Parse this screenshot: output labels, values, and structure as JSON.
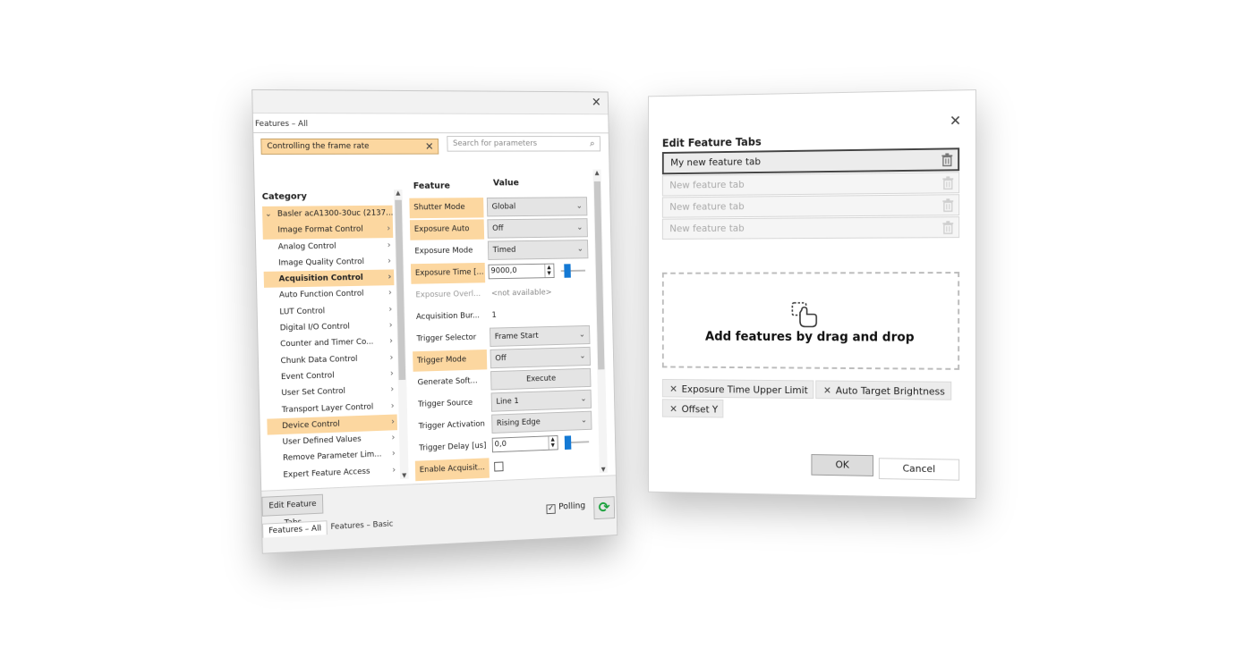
{
  "features_panel": {
    "tab_title": "Features – All",
    "filter_text": "Controlling the frame rate",
    "search_placeholder": "Search for parameters",
    "category_header": "Category",
    "feature_header": "Feature",
    "value_header": "Value",
    "categories": [
      {
        "label": "Basler acA1300-30uc (2137...",
        "highlight": true,
        "bold": false,
        "expanded": true
      },
      {
        "label": "Image Format Control",
        "highlight": true,
        "bold": false
      },
      {
        "label": "Analog Control",
        "highlight": false,
        "bold": false
      },
      {
        "label": "Image Quality Control",
        "highlight": false,
        "bold": false
      },
      {
        "label": "Acquisition Control",
        "highlight": true,
        "bold": true
      },
      {
        "label": "Auto Function Control",
        "highlight": false,
        "bold": false
      },
      {
        "label": "LUT Control",
        "highlight": false,
        "bold": false
      },
      {
        "label": "Digital I/O Control",
        "highlight": false,
        "bold": false
      },
      {
        "label": "Counter and Timer Co...",
        "highlight": false,
        "bold": false
      },
      {
        "label": "Chunk Data Control",
        "highlight": false,
        "bold": false
      },
      {
        "label": "Event Control",
        "highlight": false,
        "bold": false
      },
      {
        "label": "User Set Control",
        "highlight": false,
        "bold": false
      },
      {
        "label": "Transport Layer Control",
        "highlight": false,
        "bold": false
      },
      {
        "label": "Device Control",
        "highlight": true,
        "bold": false
      },
      {
        "label": "User Defined Values",
        "highlight": false,
        "bold": false
      },
      {
        "label": "Remove Parameter Lim...",
        "highlight": false,
        "bold": false
      },
      {
        "label": "Expert Feature Access",
        "highlight": false,
        "bold": false
      }
    ],
    "features": [
      {
        "label": "Shutter Mode",
        "highlight": true,
        "kind": "dropdown",
        "value": "Global"
      },
      {
        "label": "Exposure Auto",
        "highlight": true,
        "kind": "dropdown",
        "value": "Off"
      },
      {
        "label": "Exposure Mode",
        "highlight": false,
        "kind": "dropdown",
        "value": "Timed"
      },
      {
        "label": "Exposure Time [...",
        "highlight": true,
        "kind": "spin",
        "value": "9000,0",
        "slider_fraction": 0.2
      },
      {
        "label": "Exposure Overl...",
        "highlight": false,
        "dim": true,
        "kind": "text",
        "value": "<not available>"
      },
      {
        "label": "Acquisition Bur...",
        "highlight": false,
        "kind": "text",
        "value": "1"
      },
      {
        "label": "Trigger Selector",
        "highlight": false,
        "kind": "dropdown",
        "value": "Frame Start"
      },
      {
        "label": "Trigger Mode",
        "highlight": true,
        "kind": "dropdown",
        "value": "Off"
      },
      {
        "label": "Generate Soft...",
        "highlight": false,
        "kind": "button",
        "value": "Execute"
      },
      {
        "label": "Trigger Source",
        "highlight": false,
        "kind": "dropdown",
        "value": "Line 1"
      },
      {
        "label": "Trigger Activation",
        "highlight": false,
        "kind": "dropdown",
        "value": "Rising Edge"
      },
      {
        "label": "Trigger Delay [us]",
        "highlight": false,
        "kind": "spin",
        "value": "0,0",
        "slider_fraction": 0.0
      },
      {
        "label": "Enable Acquisit...",
        "highlight": true,
        "kind": "checkbox",
        "value": ""
      }
    ],
    "edit_tabs_button": "Edit Feature Tabs",
    "bottom_tabs": [
      "Features – All",
      "Features – Basic"
    ],
    "polling_label": "Polling",
    "polling_checked": true,
    "accent_color": "#fcd7a0"
  },
  "edit_dialog": {
    "title": "Edit Feature Tabs",
    "tabs": [
      {
        "label": "My new feature tab",
        "selected": true
      },
      {
        "label": "New feature tab",
        "selected": false
      },
      {
        "label": "New feature tab",
        "selected": false
      },
      {
        "label": "New feature tab",
        "selected": false
      }
    ],
    "drop_zone_text": "Add features by drag and drop",
    "chips": [
      "Exposure Time Upper Limit",
      "Auto Target Brightness",
      "Offset Y"
    ],
    "ok_label": "OK",
    "cancel_label": "Cancel"
  }
}
